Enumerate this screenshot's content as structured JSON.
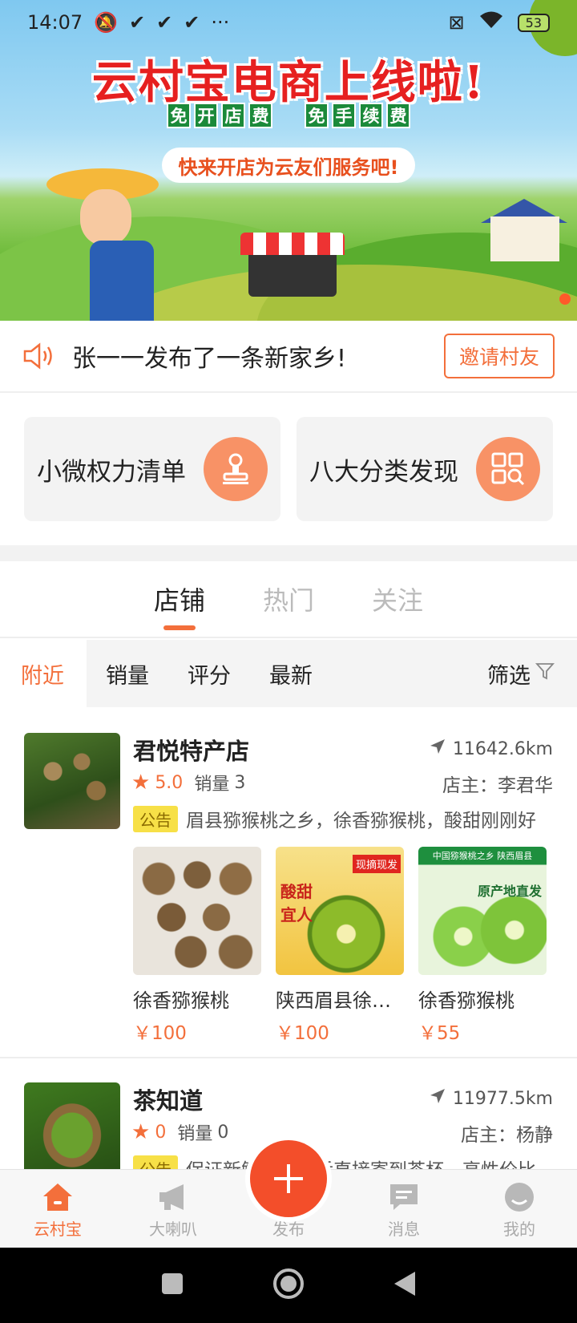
{
  "status_bar": {
    "time": "14:07",
    "battery": "53"
  },
  "banner": {
    "title": "云村宝电商上线啦!",
    "tag_group_1": [
      "免",
      "开",
      "店",
      "费"
    ],
    "tag_group_2": [
      "免",
      "手",
      "续",
      "费"
    ],
    "slogan": "快来开店为云友们服务吧!"
  },
  "announcement": {
    "text": "张一一发布了一条新家乡!",
    "invite_label": "邀请村友"
  },
  "features": [
    {
      "label": "小微权力清单",
      "icon": "stamp-icon"
    },
    {
      "label": "八大分类发现",
      "icon": "category-search-icon"
    }
  ],
  "tabs": [
    {
      "label": "店铺",
      "active": true
    },
    {
      "label": "热门",
      "active": false
    },
    {
      "label": "关注",
      "active": false
    }
  ],
  "filters": {
    "items": [
      "附近",
      "销量",
      "评分",
      "最新"
    ],
    "active": "附近",
    "filter_label": "筛选"
  },
  "stores": [
    {
      "name": "君悦特产店",
      "distance": "11642.6km",
      "rating": "5.0",
      "sales_label": "销量",
      "sales": "3",
      "owner": "店主：李君华",
      "notice_tag": "公告",
      "notice": "眉县猕猴桃之乡，徐香猕猴桃，酸甜刚刚好",
      "products": [
        {
          "name": "徐香猕猴桃",
          "price": "￥100"
        },
        {
          "name": "陕西眉县徐香猕猴桃",
          "price": "￥100"
        },
        {
          "name": "徐香猕猴桃",
          "price": "￥55"
        }
      ],
      "product_overlays": {
        "p2_badge": "现摘现发",
        "p2_text": "酸甜宜人",
        "p3_title": "中国猕猴桃之乡 陕西眉县",
        "p3_text": "原产地直发"
      }
    },
    {
      "name": "茶知道",
      "distance": "11977.5km",
      "rating": "0",
      "sales_label": "销量",
      "sales": "0",
      "owner": "店主：杨静",
      "notice_tag": "公告",
      "notice": "保证新鲜，采摘后直接寄到茶杯，高性价比"
    }
  ],
  "bottom_nav": [
    {
      "label": "云村宝",
      "icon": "home-icon",
      "active": true
    },
    {
      "label": "大喇叭",
      "icon": "megaphone-icon",
      "active": false
    },
    {
      "label": "发布",
      "icon": "plus-icon",
      "active": false
    },
    {
      "label": "消息",
      "icon": "message-icon",
      "active": false
    },
    {
      "label": "我的",
      "icon": "profile-icon",
      "active": false
    }
  ],
  "colors": {
    "accent": "#f36f3b",
    "fab": "#f34e2a",
    "notice_tag": "#f7e047"
  }
}
